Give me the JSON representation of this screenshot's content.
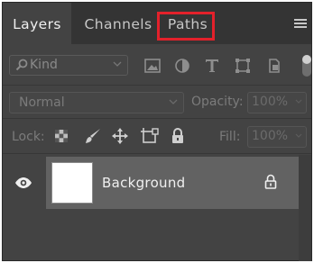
{
  "tabs": [
    {
      "label": "Layers",
      "active": true
    },
    {
      "label": "Channels",
      "active": false
    },
    {
      "label": "Paths",
      "active": false,
      "highlighted": true
    }
  ],
  "panel_menu_icon": "hamburger-icon",
  "filter": {
    "kind_label": "Kind",
    "icons": [
      "pixel-layer-filter-icon",
      "adjustment-layer-filter-icon",
      "type-layer-filter-icon",
      "shape-layer-filter-icon",
      "smart-object-filter-icon"
    ]
  },
  "blend": {
    "mode": "Normal",
    "opacity_label": "Opacity:",
    "opacity_value": "100%"
  },
  "lock": {
    "label": "Lock:",
    "icons": [
      "lock-transparent-pixels-icon",
      "lock-image-pixels-icon",
      "lock-position-icon",
      "prevent-autonest-icon",
      "lock-all-icon"
    ],
    "fill_label": "Fill:",
    "fill_value": "100%"
  },
  "layers": [
    {
      "name": "Background",
      "visible": true,
      "locked": true
    }
  ],
  "colors": {
    "panel_bg": "#434343",
    "tab_bar_bg": "#343434",
    "selected_row": "#626262",
    "highlight": "#e3212b"
  }
}
